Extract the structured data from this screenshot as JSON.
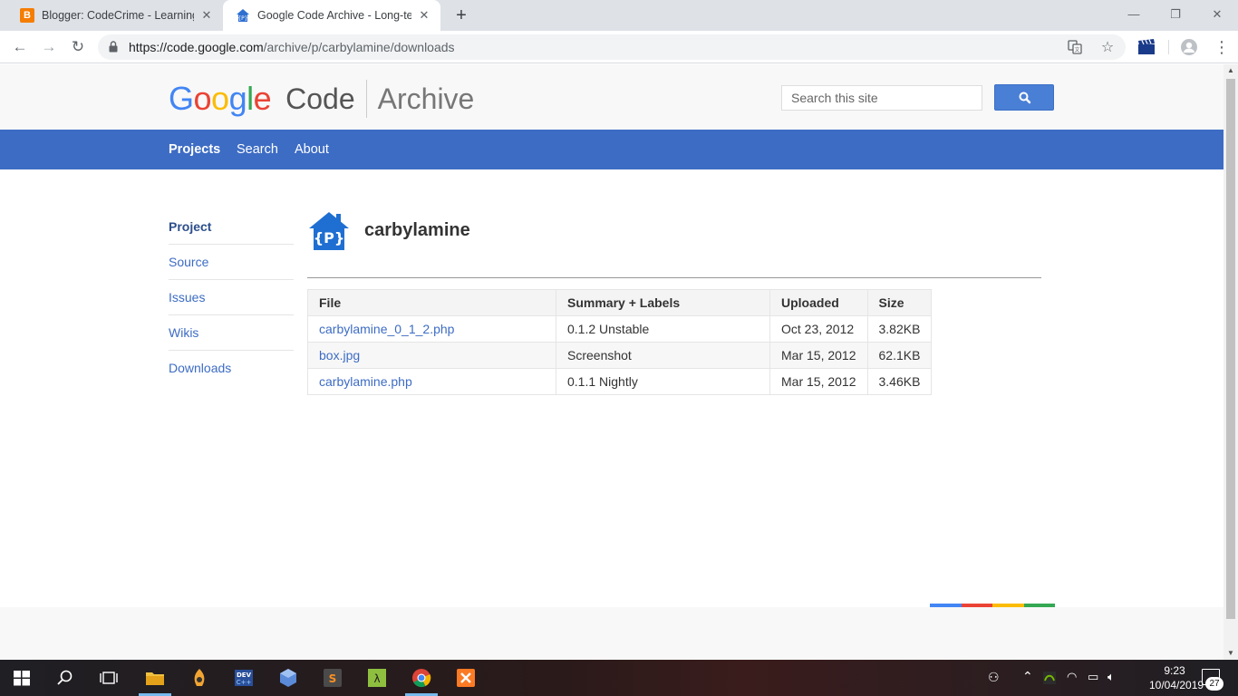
{
  "browser": {
    "tabs": [
      {
        "title": "Blogger: CodeCrime - Learning T",
        "favicon": "blogger-icon"
      },
      {
        "title": "Google Code Archive - Long-term",
        "favicon": "code-archive-icon"
      }
    ],
    "url_host": "https://code.google.com",
    "url_path": "/archive/p/carbylamine/downloads"
  },
  "header": {
    "logo_code": "Code",
    "logo_archive": "Archive",
    "search_placeholder": "Search this site"
  },
  "nav": {
    "projects": "Projects",
    "search": "Search",
    "about": "About"
  },
  "sidebar": {
    "items": [
      {
        "label": "Project"
      },
      {
        "label": "Source"
      },
      {
        "label": "Issues"
      },
      {
        "label": "Wikis"
      },
      {
        "label": "Downloads"
      }
    ]
  },
  "project": {
    "name": "carbylamine"
  },
  "downloads": {
    "headers": [
      "File",
      "Summary + Labels",
      "Uploaded",
      "Size"
    ],
    "rows": [
      {
        "file": "carbylamine_0_1_2.php",
        "summary": "0.1.2 Unstable",
        "uploaded": "Oct 23, 2012",
        "size": "3.82KB"
      },
      {
        "file": "box.jpg",
        "summary": "Screenshot",
        "uploaded": "Mar 15, 2012",
        "size": "62.1KB"
      },
      {
        "file": "carbylamine.php",
        "summary": "0.1.1 Nightly",
        "uploaded": "Mar 15, 2012",
        "size": "3.46KB"
      }
    ]
  },
  "taskbar": {
    "time": "9:23",
    "date": "10/04/2019",
    "notifications": "27"
  },
  "colors": {
    "nav_blue": "#3d6cc4",
    "link_blue": "#3d6cc4",
    "google_blue": "#4285f4",
    "google_red": "#ea4335",
    "google_yellow": "#fbbc05",
    "google_green": "#34a853"
  }
}
